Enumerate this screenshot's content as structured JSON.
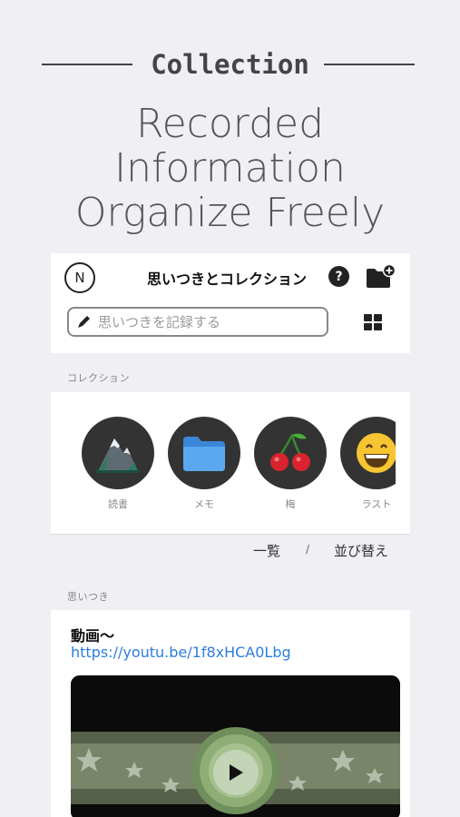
{
  "promo": {
    "section_label": "Collection",
    "headline_lines": [
      "Recorded",
      "Information",
      "Organize Freely"
    ]
  },
  "header": {
    "avatar_letter": "N",
    "title": "思いつきとコレクション",
    "help_icon": "question-circle-icon",
    "folder_icon": "folder-add-icon"
  },
  "search": {
    "placeholder": "思いつきを記録する",
    "icon": "pencil-icon"
  },
  "view_toggle_icon": "grid-view-icon",
  "collections": {
    "section_label": "コレクション",
    "items": [
      {
        "label": "読書",
        "icon": "mountain-icon"
      },
      {
        "label": "メモ",
        "icon": "folder-icon"
      },
      {
        "label": "梅",
        "icon": "cherry-icon"
      },
      {
        "label": "ラスト",
        "icon": "grinning-face-icon"
      }
    ]
  },
  "sort_bar": {
    "list_label": "一覧",
    "separator": "/",
    "sort_label": "並び替え"
  },
  "ideas": {
    "section_label": "思いつき",
    "items": [
      {
        "title": "動画〜",
        "link": "https://youtu.be/1f8xHCA0Lbg",
        "thumbnail_icon": "play-icon"
      }
    ]
  },
  "colors": {
    "background": "#efeff4",
    "link": "#2a7de1",
    "folder_blue": "#4a9ee8",
    "cherry_red": "#d9232e"
  }
}
